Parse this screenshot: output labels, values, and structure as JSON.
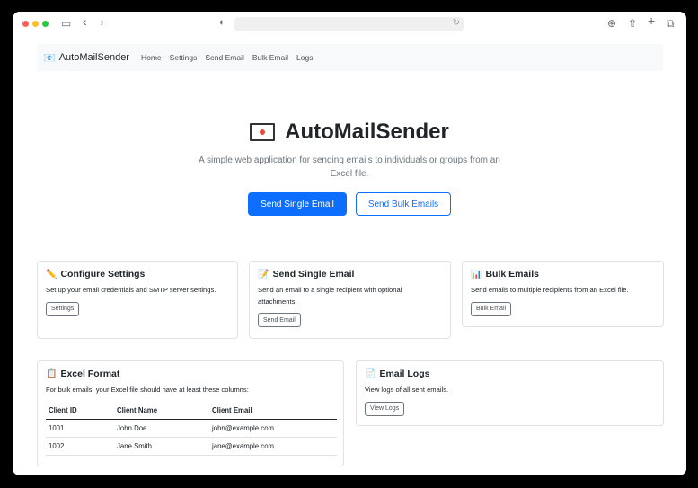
{
  "browser": {
    "icons": {
      "sidebar": "sidebar-icon",
      "back": "chevron-left-icon",
      "forward": "chevron-right-icon",
      "shield": "privacy-shield-icon",
      "reload": "reload-icon",
      "download": "download-icon",
      "share": "share-icon",
      "new_tab": "plus-icon",
      "tabs": "tabs-overview-icon"
    },
    "url": ""
  },
  "navbar": {
    "brand": "AutoMailSender",
    "brand_icon": "envelope-icon",
    "links": [
      "Home",
      "Settings",
      "Send Email",
      "Bulk Email",
      "Logs"
    ]
  },
  "hero": {
    "title": "AutoMailSender",
    "subtitle": "A simple web application for sending emails to individuals or groups from an Excel file.",
    "primary_button": "Send Single Email",
    "secondary_button": "Send Bulk Emails"
  },
  "cards": {
    "settings": {
      "title": "Configure Settings",
      "icon": "pencil-icon",
      "text": "Set up your email credentials and SMTP server settings.",
      "button": "Settings"
    },
    "single": {
      "title": "Send Single Email",
      "icon": "memo-icon",
      "text": "Send an email to a single recipient with optional attachments.",
      "button": "Send Email"
    },
    "bulk": {
      "title": "Bulk Emails",
      "icon": "bar-chart-icon",
      "text": "Send emails to multiple recipients from an Excel file.",
      "button": "Bulk Email"
    },
    "excel": {
      "title": "Excel Format",
      "icon": "clipboard-icon",
      "text": "For bulk emails, your Excel file should have at least these columns:",
      "columns": [
        "Client ID",
        "Client Name",
        "Client Email"
      ],
      "rows": [
        [
          "1001",
          "John Doe",
          "john@example.com"
        ],
        [
          "1002",
          "Jane Smith",
          "jane@example.com"
        ]
      ]
    },
    "logs": {
      "title": "Email Logs",
      "icon": "document-icon",
      "text": "View logs of all sent emails.",
      "button": "View Logs"
    }
  },
  "colors": {
    "primary": "#0d6efd",
    "navbar_bg": "#f8f9fa",
    "border": "#dee2e6"
  }
}
